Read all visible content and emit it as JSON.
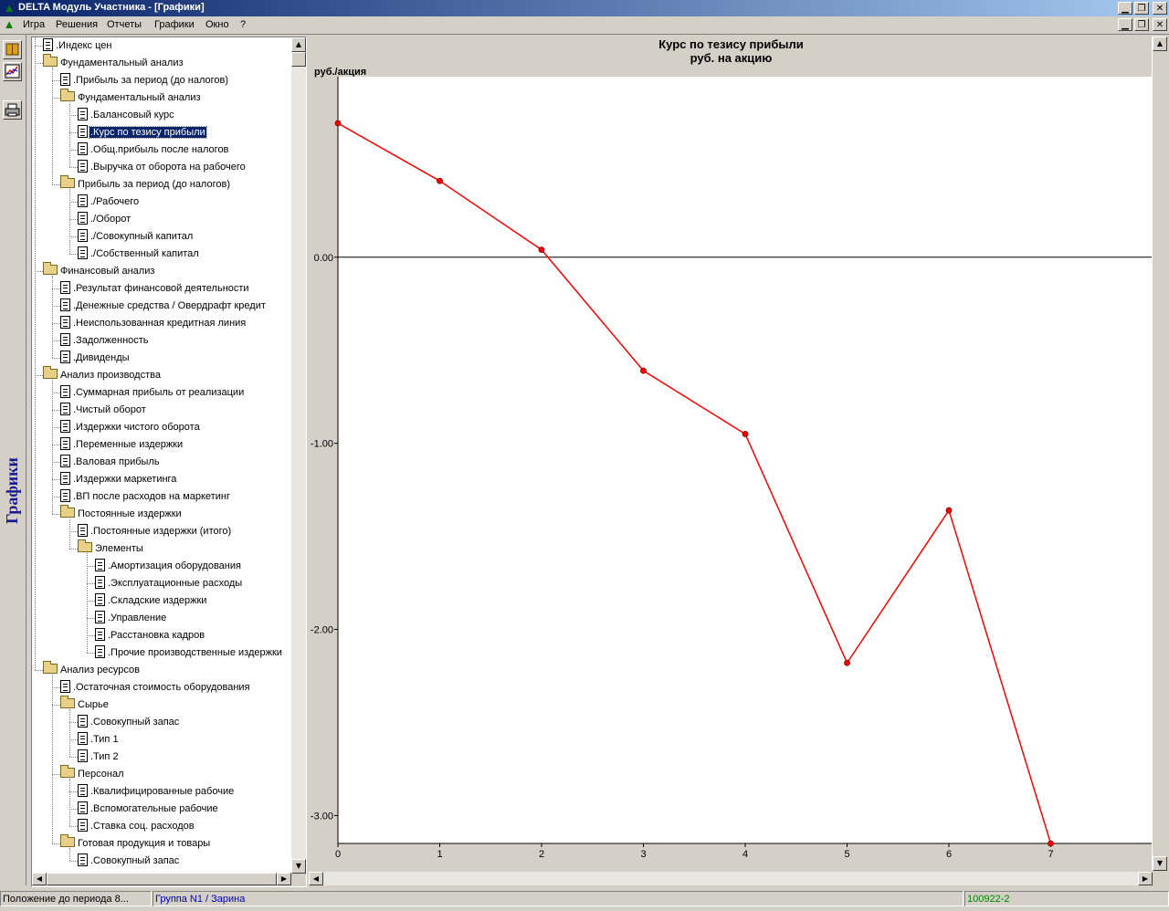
{
  "window": {
    "title": "DELTA Модуль Участника - [Графики]",
    "minimize": "▁",
    "maximize": "❐",
    "close": "✕"
  },
  "menu": {
    "items": [
      "Игра",
      "Решения",
      "Отчеты",
      "Графики",
      "Окно",
      "?"
    ]
  },
  "sidebar": {
    "vertical_label": "Графики",
    "tools": [
      "book-icon",
      "chart-icon",
      "printer-icon"
    ]
  },
  "tree": {
    "nodes": [
      {
        "label": ".Индекс цен",
        "depth": 0,
        "type": "doc"
      },
      {
        "label": "Фундаментальный анализ",
        "depth": 0,
        "type": "folder"
      },
      {
        "label": ".Прибыль за период (до налогов)",
        "depth": 1,
        "type": "doc"
      },
      {
        "label": "Фундаментальный анализ",
        "depth": 1,
        "type": "folder"
      },
      {
        "label": ".Балансовый курс",
        "depth": 2,
        "type": "doc"
      },
      {
        "label": ".Курс по тезису прибыли",
        "depth": 2,
        "type": "doc",
        "selected": true
      },
      {
        "label": ".Общ.прибыль после налогов",
        "depth": 2,
        "type": "doc"
      },
      {
        "label": ".Выручка от оборота на рабочего",
        "depth": 2,
        "type": "doc"
      },
      {
        "label": "Прибыль за период (до налогов)",
        "depth": 1,
        "type": "folder"
      },
      {
        "label": "./Рабочего",
        "depth": 2,
        "type": "doc"
      },
      {
        "label": "./Оборот",
        "depth": 2,
        "type": "doc"
      },
      {
        "label": "./Совокупный капитал",
        "depth": 2,
        "type": "doc"
      },
      {
        "label": "./Собственный капитал",
        "depth": 2,
        "type": "doc"
      },
      {
        "label": "Финансовый анализ",
        "depth": 0,
        "type": "folder"
      },
      {
        "label": ".Результат финансовой деятельности",
        "depth": 1,
        "type": "doc"
      },
      {
        "label": ".Денежные средства / Овердрафт кредит",
        "depth": 1,
        "type": "doc"
      },
      {
        "label": ".Неиспользованная кредитная линия",
        "depth": 1,
        "type": "doc"
      },
      {
        "label": ".Задолженность",
        "depth": 1,
        "type": "doc"
      },
      {
        "label": ".Дивиденды",
        "depth": 1,
        "type": "doc"
      },
      {
        "label": "Анализ производства",
        "depth": 0,
        "type": "folder"
      },
      {
        "label": ".Суммарная прибыль от реализации",
        "depth": 1,
        "type": "doc"
      },
      {
        "label": ".Чистый оборот",
        "depth": 1,
        "type": "doc"
      },
      {
        "label": ".Издержки чистого оборота",
        "depth": 1,
        "type": "doc"
      },
      {
        "label": ".Переменные издержки",
        "depth": 1,
        "type": "doc"
      },
      {
        "label": ".Валовая прибыль",
        "depth": 1,
        "type": "doc"
      },
      {
        "label": ".Издержки маркетинга",
        "depth": 1,
        "type": "doc"
      },
      {
        "label": ".ВП после расходов на маркетинг",
        "depth": 1,
        "type": "doc"
      },
      {
        "label": "Постоянные издержки",
        "depth": 1,
        "type": "folder"
      },
      {
        "label": ".Постоянные издержки (итого)",
        "depth": 2,
        "type": "doc"
      },
      {
        "label": "Элементы",
        "depth": 2,
        "type": "folder"
      },
      {
        "label": ".Амортизация оборудования",
        "depth": 3,
        "type": "doc"
      },
      {
        "label": ".Эксплуатационные расходы",
        "depth": 3,
        "type": "doc"
      },
      {
        "label": ".Складские издержки",
        "depth": 3,
        "type": "doc"
      },
      {
        "label": ".Управление",
        "depth": 3,
        "type": "doc"
      },
      {
        "label": ".Расстановка кадров",
        "depth": 3,
        "type": "doc"
      },
      {
        "label": ".Прочие производственные издержки",
        "depth": 3,
        "type": "doc"
      },
      {
        "label": "Анализ ресурсов",
        "depth": 0,
        "type": "folder"
      },
      {
        "label": ".Остаточная стоимость оборудования",
        "depth": 1,
        "type": "doc"
      },
      {
        "label": "Сырье",
        "depth": 1,
        "type": "folder"
      },
      {
        "label": ".Совокупный запас",
        "depth": 2,
        "type": "doc"
      },
      {
        "label": ".Тип 1",
        "depth": 2,
        "type": "doc"
      },
      {
        "label": ".Тип 2",
        "depth": 2,
        "type": "doc"
      },
      {
        "label": "Персонал",
        "depth": 1,
        "type": "folder"
      },
      {
        "label": ".Квалифицированные рабочие",
        "depth": 2,
        "type": "doc"
      },
      {
        "label": ".Вспомогательные рабочие",
        "depth": 2,
        "type": "doc"
      },
      {
        "label": ".Ставка соц. расходов",
        "depth": 2,
        "type": "doc"
      },
      {
        "label": "Готовая продукция и товары",
        "depth": 1,
        "type": "folder"
      },
      {
        "label": ".Совокупный запас",
        "depth": 2,
        "type": "doc"
      }
    ]
  },
  "chart_data": {
    "type": "line",
    "title": "Курс по тезису прибыли",
    "subtitle": "руб. на акцию",
    "ylabel": "руб./акция",
    "x": [
      0,
      1,
      2,
      3,
      4,
      5,
      6,
      7
    ],
    "series": [
      {
        "values": [
          0.72,
          0.41,
          0.04,
          -0.61,
          -0.95,
          -2.18,
          -1.36,
          -3.15
        ],
        "color": "#ff0000"
      }
    ],
    "xlim": [
      0,
      8
    ],
    "ylim": [
      -3.15,
      0.97
    ],
    "xticks": [
      0,
      1,
      2,
      3,
      4,
      5,
      6,
      7
    ],
    "yticks": [
      0.0,
      -1.0,
      -2.0,
      -3.0
    ],
    "ytick_labels": [
      "0.00",
      "-1.00",
      "-2.00",
      "-3.00"
    ],
    "zero_line": true,
    "grid": false
  },
  "status": {
    "left": "Положение до периода 8...",
    "group": "Группа N1 / Зарина",
    "code": "100922-2"
  }
}
